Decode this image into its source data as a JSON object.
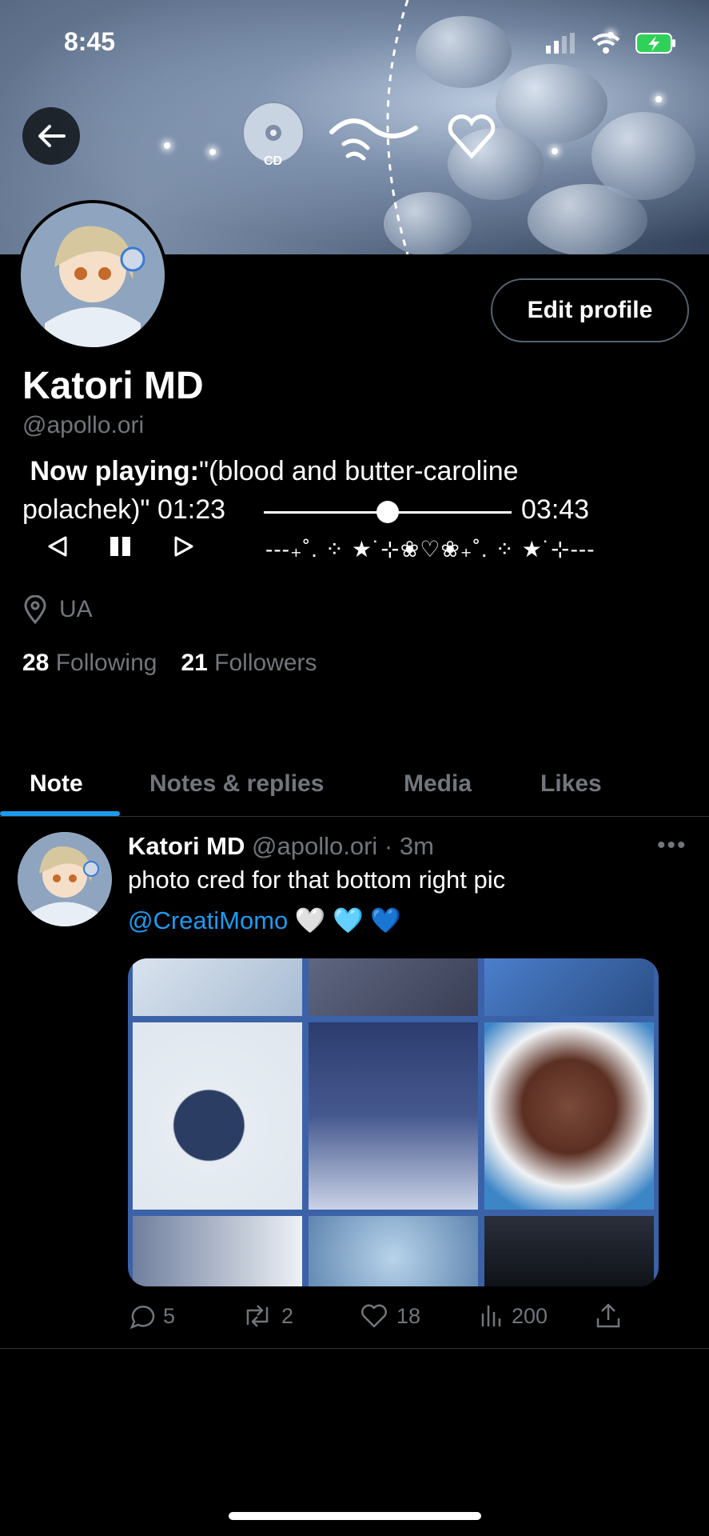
{
  "status_bar": {
    "time": "8:45"
  },
  "banner": {
    "cd_label": "CD"
  },
  "profile": {
    "edit_button": "Edit profile",
    "display_name": "Katori MD",
    "handle": "@apollo.ori",
    "bio": {
      "now_playing_label": "Now playing:",
      "song_part1": "\"(blood and butter-caroline",
      "song_part2": "polachek)\" 01:23",
      "time_total": "03:43",
      "progress_fraction": 0.5,
      "decor": "---₊˚. ⁘ ★˙⊹❀♡❀₊˚. ⁘ ★˙⊹---"
    },
    "location": "UA",
    "following_count": "28",
    "following_label": "Following",
    "followers_count": "21",
    "followers_label": "Followers"
  },
  "tabs": [
    {
      "label": "Note"
    },
    {
      "label": "Notes & replies"
    },
    {
      "label": "Media"
    },
    {
      "label": "Likes"
    }
  ],
  "post": {
    "author": "Katori MD",
    "meta": "@apollo.ori · 3m",
    "more": "•••",
    "text": "photo cred for that bottom right pic",
    "mention": "@CreatiMomo",
    "hearts": "🤍 🩵 💙",
    "actions": {
      "replies": "5",
      "reposts": "2",
      "likes": "18",
      "views": "200"
    }
  },
  "colors": {
    "accent": "#1d9bf0",
    "muted": "#71767b",
    "background": "#000000"
  }
}
